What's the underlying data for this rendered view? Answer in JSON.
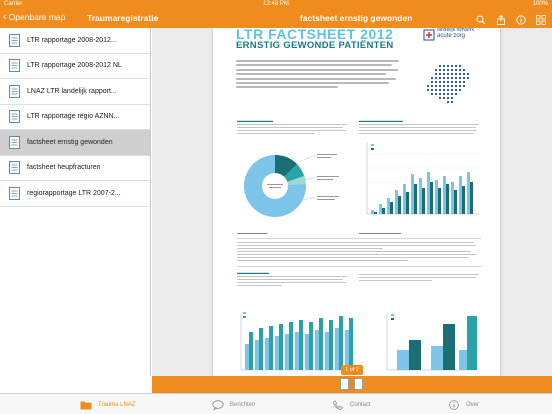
{
  "status": {
    "carrier": "Carrier",
    "time": "12:48 PM",
    "battery": "100%"
  },
  "nav": {
    "back_label": "Openbare map",
    "left_title": "Traumaregistratie",
    "title": "factsheet ernstig gewonden",
    "icons": [
      "search-icon",
      "share-icon",
      "info-icon",
      "grid-icon"
    ]
  },
  "documents": [
    {
      "label": "LTR rapportage 2008-2012...",
      "selected": false
    },
    {
      "label": "LTR rapportage 2008-2012 NL",
      "selected": false
    },
    {
      "label": "LNAZ LTR landelijk rapport...",
      "selected": false
    },
    {
      "label": "LTR rapportage regio AZNN...",
      "selected": false
    },
    {
      "label": "factsheet ernstig gewonden",
      "selected": true
    },
    {
      "label": "factsheet heupfracturen",
      "selected": false
    },
    {
      "label": "regiorapportage LTR 2007-2...",
      "selected": false
    }
  ],
  "page": {
    "h1": "LTR FACTSHEET 2012",
    "h2": "ERNSTIG GEWONDE PATIËNTEN",
    "logo_line1": "landelijk netwerk",
    "logo_line2": "acute zorg",
    "colors": {
      "teal_dark": "#1b6f74",
      "teal": "#2aa3a8",
      "light_blue": "#7cc4e8",
      "heading": "#5fc3df"
    }
  },
  "pager": {
    "label": "1 of 2"
  },
  "tabs": [
    {
      "label": "Trauma LNAZ",
      "icon": "folder-icon",
      "active": true
    },
    {
      "label": "Berichten",
      "icon": "chat-icon",
      "active": false
    },
    {
      "label": "Contact",
      "icon": "phone-icon",
      "active": false
    },
    {
      "label": "Over",
      "icon": "info-icon",
      "active": false
    }
  ]
}
